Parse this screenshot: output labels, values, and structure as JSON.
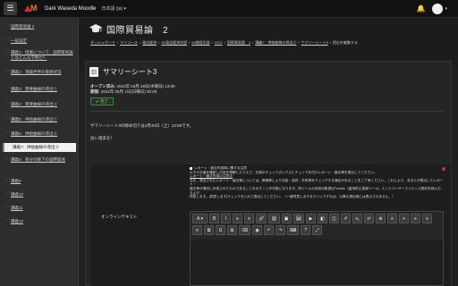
{
  "navbar": {
    "menu_icon": "☰",
    "brand_name": "Dark Waseda Moodle",
    "language": "日本語 (ja) ▾",
    "bell_icon": "🔔",
    "caret": "▾"
  },
  "sidebar": {
    "items": [
      {
        "label": "国際貿易論 2",
        "icon": "folder-icon"
      },
      {
        "label": "一般設定",
        "icon": "folder-icon"
      },
      {
        "label": "講義1：授業について、国際貿易論とはどんな学問か？",
        "icon": "folder-icon"
      },
      {
        "label": "講義2：現論世界の貿易状況",
        "icon": "folder-icon"
      },
      {
        "label": "講義3：需要曲線の導出①",
        "icon": "folder-icon"
      },
      {
        "label": "講義4：需要曲線の導出②",
        "icon": "folder-icon"
      },
      {
        "label": "講義5：供給曲線の導出①",
        "icon": "folder-icon"
      },
      {
        "label": "講義6：供給曲線の導出②",
        "icon": "folder-icon"
      },
      {
        "label": "講義7：供給曲線の導出③",
        "icon": "folder-icon"
      },
      {
        "label": "講義8：部分均衡下の国際貿易",
        "icon": "folder-icon"
      },
      {
        "label": "講義9",
        "icon": "folder-icon"
      },
      {
        "label": "講義10",
        "icon": "folder-icon"
      },
      {
        "label": "講義11",
        "icon": "folder-icon"
      },
      {
        "label": "講義12",
        "icon": "folder-icon"
      }
    ]
  },
  "header": {
    "title": "国際貿易論　2",
    "breadcrumbs": [
      "ダッシュボード",
      "マイコース",
      "政治経済",
      "2E政治経済学部",
      "50政経学部",
      "2022",
      "国際貿易論　2",
      "講義7：供給曲線の導出③",
      "サマリーシート3",
      "提出を編集する"
    ]
  },
  "activity": {
    "title": "サマリーシート3",
    "open_label": "オープン済み:",
    "open_value": "2022年 04月 28日(木曜日) 13:00",
    "due_label": "期限:",
    "due_value": "2022年 05月 1日(日曜日) 00:00",
    "done_label": "✔ 完了",
    "description_line1": "サマリーシート3の締め切りは4月30日（土）23:59です。",
    "description_line2": "良い週末を！"
  },
  "submission": {
    "intro_heading": "レポート・論文作成時に関する注意",
    "intro_line1": "以下の文章を確認し内容を理解したうえで、左側のチェックボックスにチェックを付けレポート・論文等を提出してください。",
    "intro_link": "レポート・論文作成の注意点",
    "intro_line2": "なお、提出されたレポート・論文等については、教員等により内容・品質・共有等をチェックする場合があることをご了承ください。これにより、あなたが提出したレポート・",
    "intro_line3": "論文等が適切に作成されたものであることを示すことが可能になります。同ツールの利用対象提出Turnitin（盗用防止指導ツール）エンドユーザーライセンス契約を読んだ、および",
    "intro_line4": "同意します。[同意します]チェックを入れて提出してください。（一度同意しますをクリックすれば、以降の提出時には表示されません。）",
    "online_text_label": "オンラインテキスト",
    "toolbar_row1": [
      "A ▾",
      "B",
      "I",
      "≡",
      "≡",
      "🔗",
      "⛓",
      "▣",
      "🖼",
      "▶",
      "◧",
      "◫",
      "#",
      "x₂",
      "x²",
      "⊕"
    ],
    "toolbar_row2": [
      "≡",
      "≡",
      "≡",
      "≡",
      "≡",
      "⧉",
      "Ω",
      "⊞",
      "⌫",
      "◉",
      "↶",
      "↷",
      "⌨",
      "?",
      "⤢"
    ]
  },
  "colors": {
    "background": "#1f1f1f",
    "sidebar": "#2d2d2d",
    "navbar": "#111111",
    "accent_red": "#c0392b",
    "accent_orange": "#e67e22",
    "done_green": "#3c8a3c"
  }
}
